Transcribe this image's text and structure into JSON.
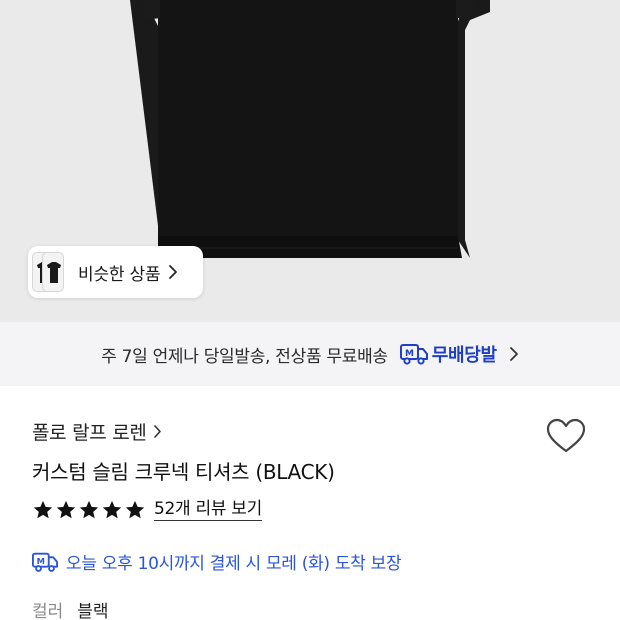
{
  "similar_products": {
    "label": "비슷한 상품"
  },
  "shipping_banner": {
    "text": "주 7일 언제나 당일발송, 전상품 무료배송",
    "badge_label": "무배당발",
    "badge_color": "#1f3fc4"
  },
  "product": {
    "brand": "폴로 랄프 로렌",
    "title": "커스텀 슬림 크루넥 티셔츠 (BLACK)",
    "rating_stars": 5,
    "reviews_label": "52개 리뷰 보기",
    "delivery_text": "오늘 오후 10시까지 결제 시 모레 (화) 도착 보장",
    "delivery_color": "#2a55d9",
    "color_label": "컬러",
    "color_value": "블랙"
  },
  "icons": {
    "favorite": "heart-outline-icon",
    "star": "star-filled-icon",
    "truck": "delivery-truck-icon",
    "chevron": "chevron-right-icon"
  }
}
